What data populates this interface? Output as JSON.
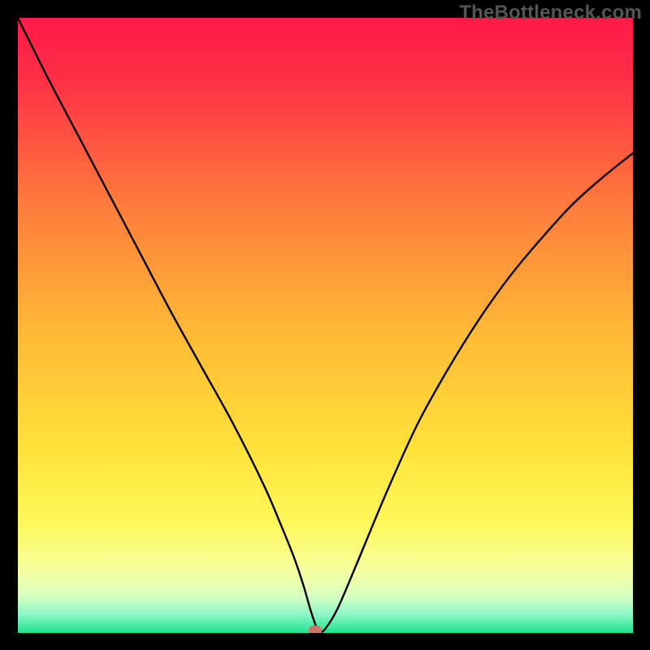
{
  "watermark": "TheBottleneck.com",
  "chart_data": {
    "type": "line",
    "title": "",
    "xlabel": "",
    "ylabel": "",
    "xlim": [
      0,
      100
    ],
    "ylim": [
      0,
      100
    ],
    "background_gradient": {
      "stops": [
        {
          "offset": 0.0,
          "color": "#ff1a48"
        },
        {
          "offset": 0.1,
          "color": "#ff2f46"
        },
        {
          "offset": 0.3,
          "color": "#ff7a3c"
        },
        {
          "offset": 0.5,
          "color": "#ffb636"
        },
        {
          "offset": 0.7,
          "color": "#ffe23a"
        },
        {
          "offset": 0.82,
          "color": "#fff85a"
        },
        {
          "offset": 0.9,
          "color": "#f6ffa0"
        },
        {
          "offset": 0.94,
          "color": "#d8ffc0"
        },
        {
          "offset": 0.97,
          "color": "#8cf7c8"
        },
        {
          "offset": 1.0,
          "color": "#1fe28d"
        }
      ]
    },
    "series": [
      {
        "name": "bottleneck-curve",
        "x": [
          0,
          5,
          10,
          15,
          20,
          25,
          30,
          35,
          40,
          43,
          45,
          46.5,
          47.5,
          48.4,
          49,
          50,
          52,
          55,
          60,
          65,
          70,
          75,
          80,
          85,
          90,
          95,
          100
        ],
        "y": [
          100,
          90,
          80.5,
          71,
          61.5,
          52,
          43,
          34,
          24,
          17,
          12,
          7.5,
          4,
          1.3,
          0.2,
          0.7,
          4,
          11,
          23,
          34,
          43,
          51,
          58,
          64,
          69.5,
          74,
          78
        ]
      }
    ],
    "marker": {
      "name": "min-point",
      "x": 48.4,
      "y": 0.4,
      "color": "#cc746c"
    }
  }
}
